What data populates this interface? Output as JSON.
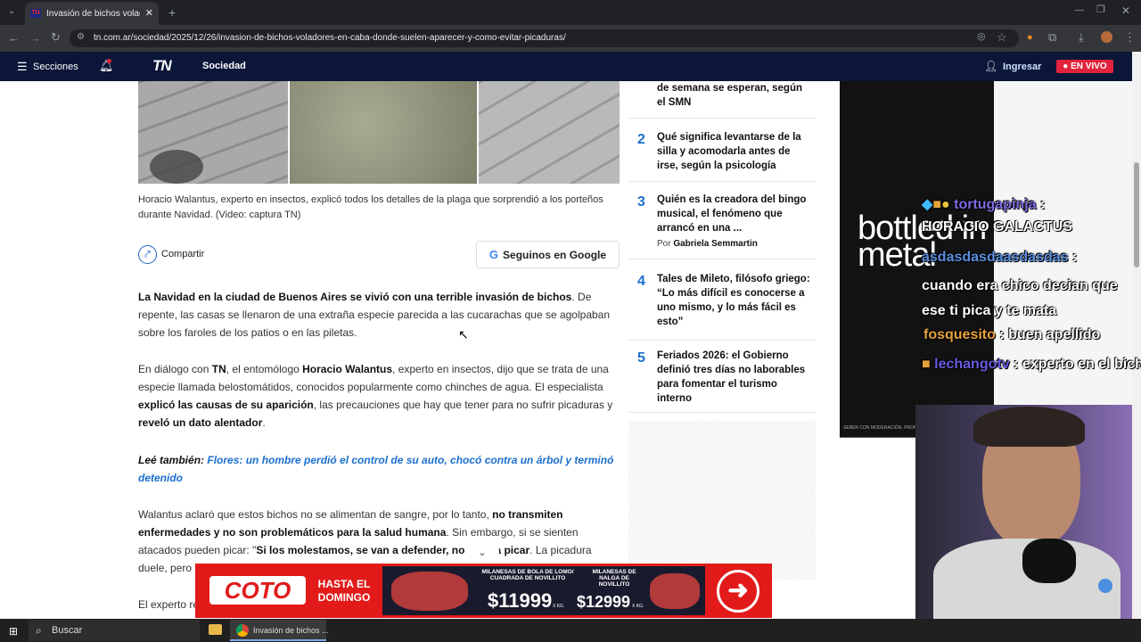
{
  "browser": {
    "tab_title": "Invasión de bichos voladores e",
    "tab_favicon": "TN",
    "url": "tn.com.ar/sociedad/2025/12/26/invasion-de-bichos-voladores-en-caba-donde-suelen-aparecer-y-como-evitar-picaduras/"
  },
  "site": {
    "menu_label": "Secciones",
    "logo": "TN",
    "section": "Sociedad",
    "login_label": "Ingresar",
    "live_label": "EN VIVO"
  },
  "article": {
    "caption": "Horacio Walantus, experto en insectos, explicó todos los detalles de la plaga que sorprendió a los porteños durante Navidad. (Video: captura TN)",
    "share_label": "Compartir",
    "google_label": "Seguinos en Google",
    "p1_bold": "La Navidad en la ciudad de Buenos Aires se vivió con una terrible invasión de bichos",
    "p1_rest": ". De repente, las casas se llenaron de una extraña especie parecida a las cucarachas que se agolpaban sobre los faroles de los patios o en las piletas.",
    "p2": [
      "En diálogo con ",
      "TN",
      ", el entomólogo ",
      "Horacio Walantus",
      ", experto en insectos, dijo que se trata de una especie llamada belostomátidos, conocidos popularmente como chinches de agua. El especialista ",
      "explicó las causas de su aparición",
      ", las precauciones que hay que tener para no sufrir picaduras y ",
      "reveló un dato alentador",
      "."
    ],
    "p3_label": "Leé también:",
    "p3_link": "Flores: un hombre perdió el control de su auto, chocó contra un árbol y terminó detenido",
    "p4": [
      "Walantus aclaró que estos bichos no se alimentan de sangre, por lo tanto, ",
      "no transmiten enfermedades y no son problemáticos para la salud humana",
      ". Sin embargo, si se sienten atacados pueden picar: \"",
      "Si los molestamos, se van a defender, nos van a picar",
      ". La p",
      "icadura duele, pero no envenena, n"
    ],
    "p5": "El experto re"
  },
  "most_read": [
    {
      "num": "",
      "title": "de semana se esperan, según el SMN",
      "by": ""
    },
    {
      "num": "2",
      "title": "Qué significa levantarse de la silla y acomodarla antes de irse, según la psicología",
      "by": ""
    },
    {
      "num": "3",
      "title": "Quién es la creadora del bingo musical, el fenómeno que arrancó en una ...",
      "by_label": "Por",
      "by": "Gabriela Semmartin"
    },
    {
      "num": "4",
      "title": "Tales de Mileto, filósofo griego: “Lo más difícil es conocerse a uno mismo, y lo más fácil es esto”",
      "by": ""
    },
    {
      "num": "5",
      "title": "Feriados 2026: el Gobierno definió tres días no laborables para fomentar el turismo interno",
      "by": ""
    }
  ],
  "video": {
    "logo_text": "bottled in metal",
    "footer": "SEBER CON MODERACIÓN. PROHIBIDA"
  },
  "chat": [
    {
      "user": "tortugapinja",
      "sep": " :",
      "msg": "HORACIO GALACTUS"
    },
    {
      "user": "asdasdasdaasdasdas",
      "sep": " :",
      "msg": "cuando era chico decian que ese ti pica y te mata"
    },
    {
      "user": "fosquesito",
      "sep": " :",
      "msg": " buen apellido"
    },
    {
      "user": "lechangotv",
      "sep": " :",
      "msg": " experto en el bicho"
    }
  ],
  "ad": {
    "brand": "COTO",
    "slogan": "HASTA EL DOMINGO",
    "offer1": "MILANESAS DE BOLA DE LOMO/ CUADRADA DE NOVILLITO",
    "price1": "$11999",
    "unit": "X KG.",
    "offer2": "MILANESAS DE NALGA DE NOVILLITO",
    "price2": "$12999"
  },
  "taskbar": {
    "search": "Buscar",
    "chrome_label": "Invasión de bichos ..."
  }
}
